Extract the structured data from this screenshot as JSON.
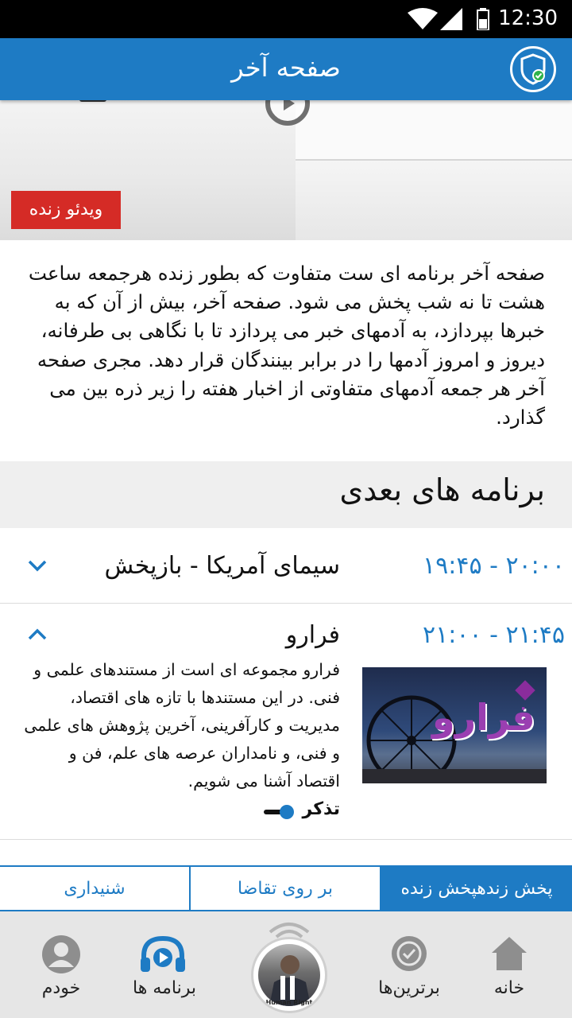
{
  "status_bar": {
    "time": "12:30"
  },
  "app_bar": {
    "title": "صفحه آخر",
    "shield_icon": "shield-check-icon"
  },
  "hero": {
    "live_badge": "ویدئو زنده",
    "accent": "#d52b26"
  },
  "description": "صفحه آخر برنامه ای ست متفاوت که بطور زنده هرجمعه ساعت هشت تا نه شب پخش می شود. صفحه آخر، بیش از آن که به خبرها بپردازد، به آدمهای خبر می پردازد تا با نگاهی بی طرفانه، دیروز و امروز آدمها را در برابر بینندگان قرار دهد. مجری صفحه آخر هر جمعه آدمهای متفاوتی از اخبار هفته را زیر ذره بین می گذارد.",
  "next_programs": {
    "header": "برنامه های بعدی",
    "items": [
      {
        "time": "۱۹:۴۵ - ۲۰:۰۰",
        "title": "سیمای آمریکا - بازپخش",
        "expanded": false
      },
      {
        "time": "۲۱:۰۰ - ۲۱:۴۵",
        "title": "فرارو",
        "expanded": true,
        "description": "فرارو مجموعه ای است از مستندهای علمی و فنی. در این مستندها با تازه های اقتصاد، مدیریت و کارآفرینی، آخرین پژوهش های علمی و فنی، و نامداران عرصه های علم، فن و اقتصاد آشنا می شویم.",
        "remind_label": "تذکر",
        "thumb_logo": "فرارو"
      }
    ]
  },
  "tabs": [
    {
      "label": "پخش زندهپخش زنده",
      "active": true
    },
    {
      "label": "بر روی تقاضا",
      "active": false
    },
    {
      "label": "شنیداری",
      "active": false
    }
  ],
  "bottom_nav": {
    "home": "خانه",
    "top": "برترین‌ها",
    "center_caption": "Human Right",
    "programs": "برنامه ها",
    "me": "خودم"
  },
  "colors": {
    "primary": "#1e7bc4",
    "live_red": "#d52b26"
  }
}
